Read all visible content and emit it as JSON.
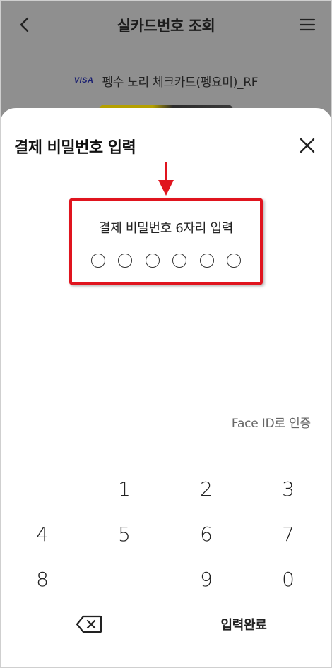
{
  "header": {
    "title": "실카드번호 조회",
    "back_icon": "chevron-left-icon",
    "menu_icon": "hamburger-menu-icon"
  },
  "card": {
    "brand": "VISA",
    "name": "펭수 노리 체크카드(펭요미)_RF"
  },
  "sheet": {
    "title": "결제 비밀번호 입력",
    "close_icon": "close-icon",
    "pin_label": "결제 비밀번호 6자리 입력",
    "pin_length": 6,
    "pin_filled": 0,
    "faceid_label": "Face ID로 인증",
    "annotation_color": "#e0141e"
  },
  "keypad": {
    "keys": [
      "1",
      "2",
      "3",
      "4",
      "5",
      "6",
      "7",
      "8",
      "9",
      "0"
    ],
    "backspace_icon": "backspace-icon",
    "done_label": "입력완료"
  }
}
